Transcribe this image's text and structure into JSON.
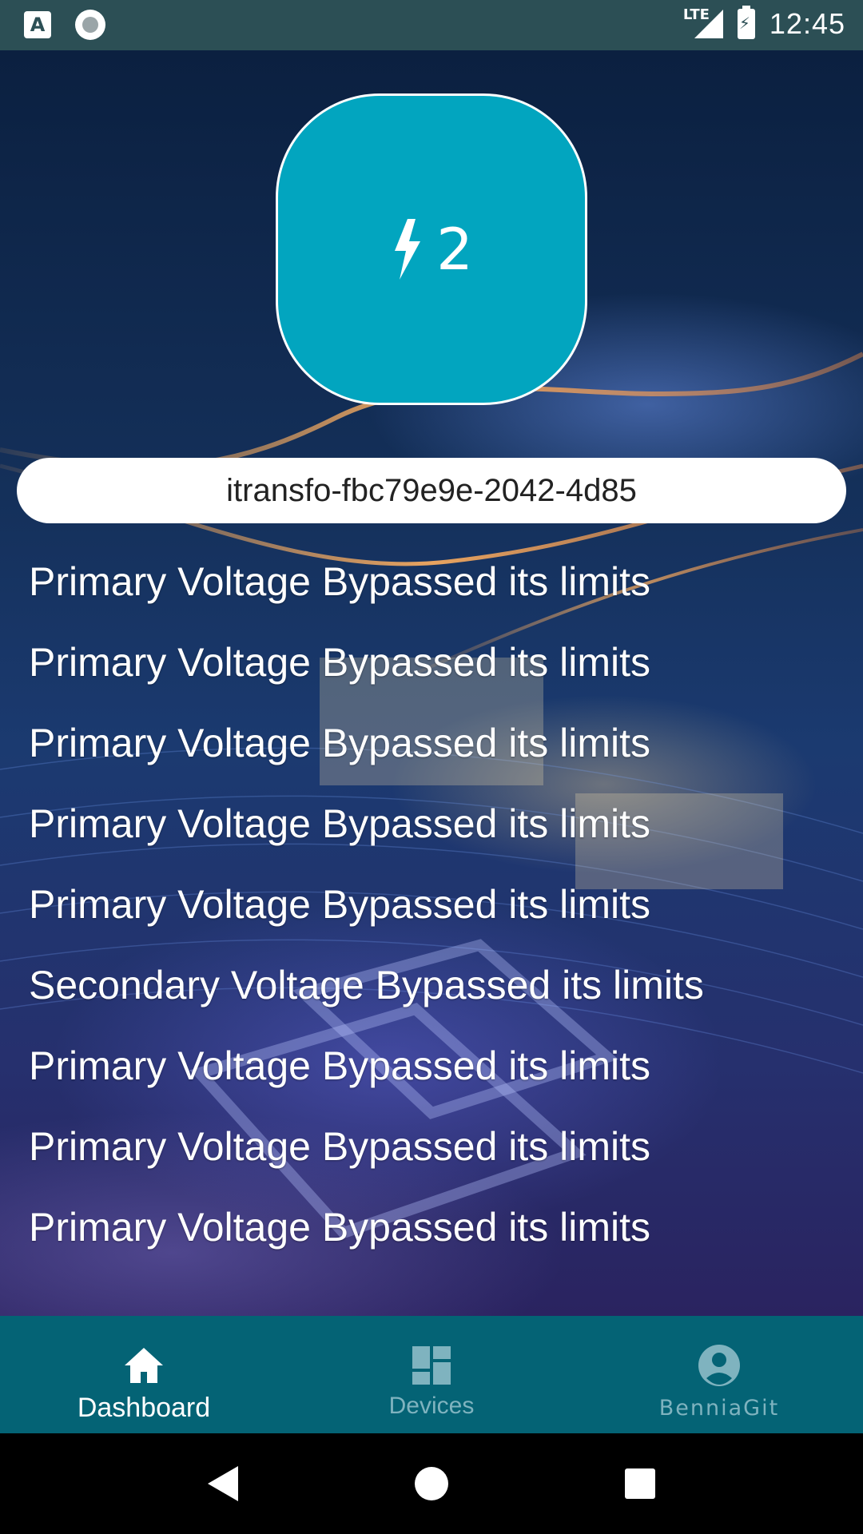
{
  "status_bar": {
    "time": "12:45",
    "network": "LTE",
    "icons": [
      "keyboard-a-icon",
      "record-icon",
      "lte-signal-icon",
      "battery-charging-icon"
    ]
  },
  "counter": {
    "icon": "bolt-icon",
    "value": "2",
    "color": "#02a5bf"
  },
  "device": {
    "id": "itransfo-fbc79e9e-2042-4d85"
  },
  "alerts": [
    "Primary Voltage Bypassed its limits",
    "Primary Voltage Bypassed its limits",
    "Primary Voltage Bypassed its limits",
    "Primary Voltage Bypassed its limits",
    "Primary Voltage Bypassed its limits",
    "Secondary Voltage Bypassed its limits",
    "Primary Voltage Bypassed its limits",
    "Primary Voltage Bypassed its limits",
    "Primary Voltage Bypassed its limits"
  ],
  "bottom_nav": {
    "dashboard": "Dashboard",
    "devices": "Devices",
    "profile": "BenniaGit",
    "active": "Dashboard",
    "background": "#046375"
  }
}
